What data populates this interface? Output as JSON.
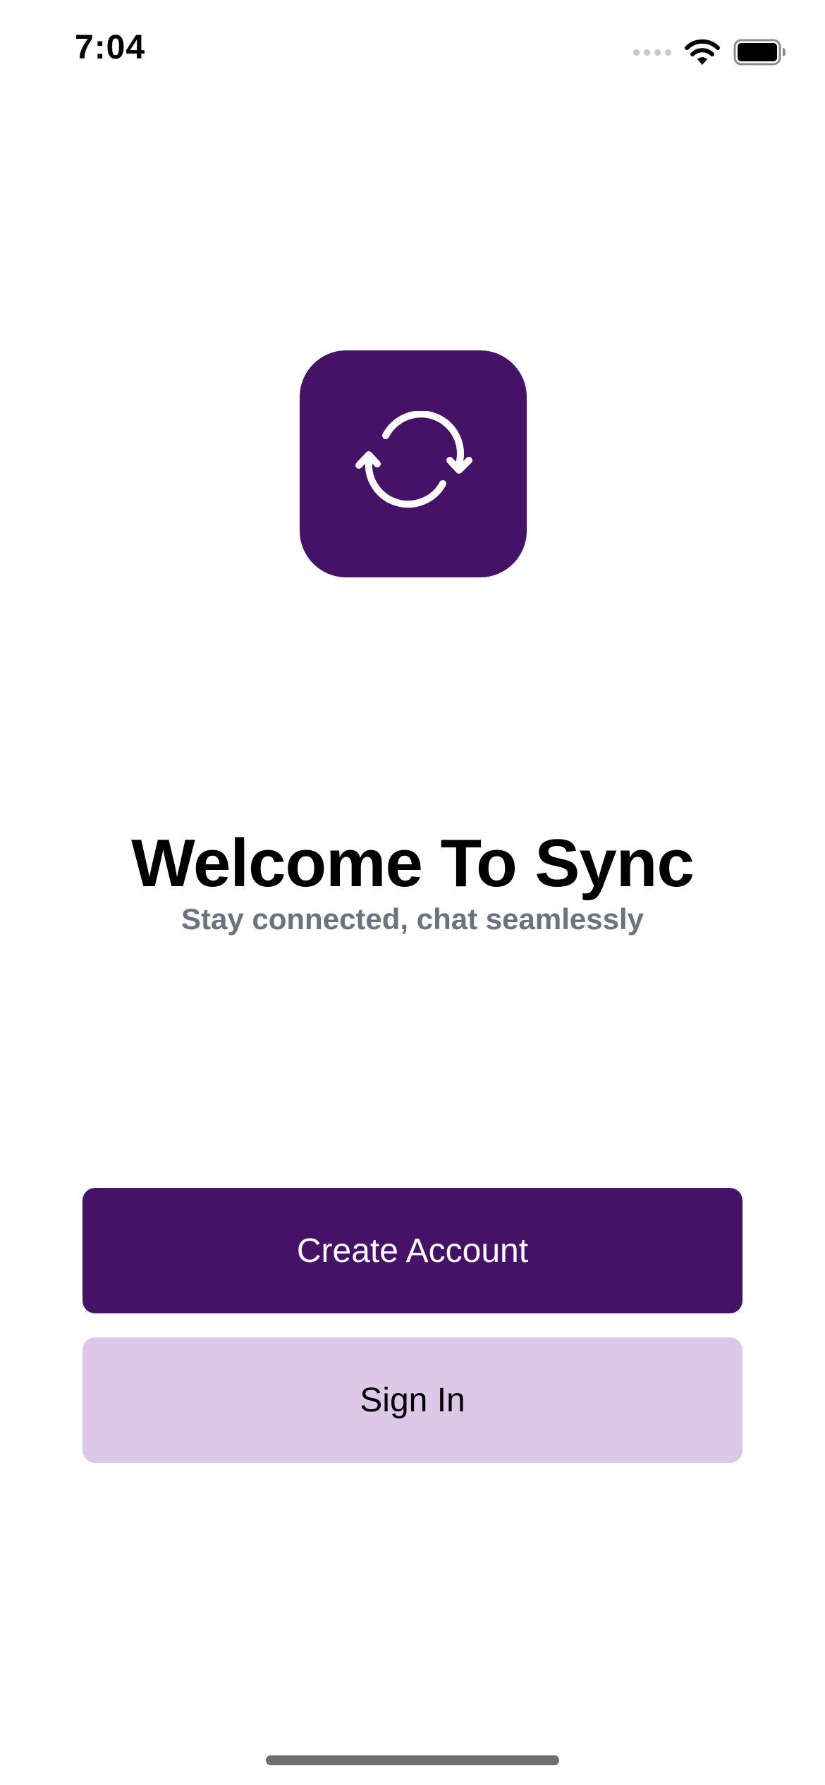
{
  "status_bar": {
    "time": "7:04",
    "signal_icon": "signal-dots-icon",
    "wifi_icon": "wifi-icon",
    "battery_icon": "battery-icon"
  },
  "logo": {
    "icon": "sync-arrows-icon",
    "tile_color": "#461268"
  },
  "welcome": {
    "title": "Welcome To Sync",
    "subtitle": "Stay connected, chat seamlessly"
  },
  "actions": {
    "create_account_label": "Create Account",
    "sign_in_label": "Sign In"
  },
  "colors": {
    "primary": "#461268",
    "secondary": "#dec8e8",
    "subtitle_text": "#6b7280"
  }
}
